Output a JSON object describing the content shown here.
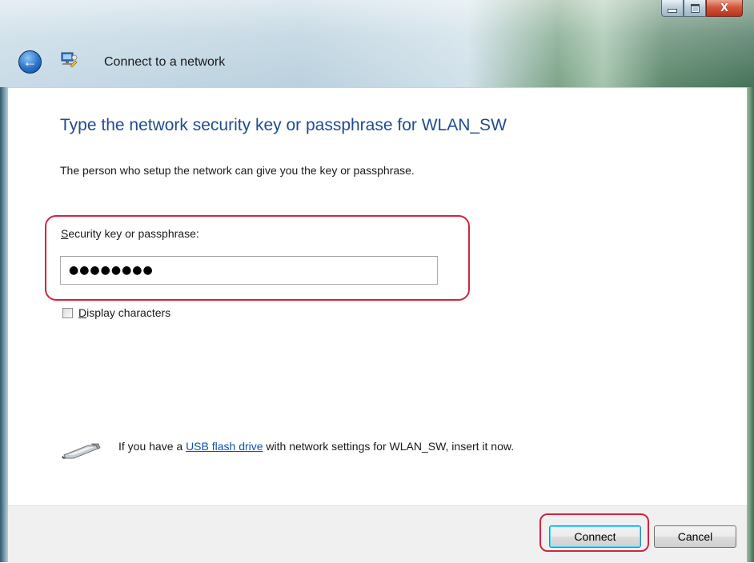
{
  "window": {
    "title": "Connect to a network",
    "controls": {
      "minimize_icon": "minimize-icon",
      "maximize_icon": "maximize-icon",
      "close_glyph": "X"
    },
    "back_glyph": "←"
  },
  "main": {
    "heading": "Type the network security key or passphrase for WLAN_SW",
    "description": "The person who setup the network can give you the key or passphrase.",
    "key_label_accel": "S",
    "key_label_rest": "ecurity key or passphrase:",
    "key_value": "●●●●●●●●",
    "display_chars_accel": "D",
    "display_chars_rest": "isplay characters",
    "display_chars_checked": false,
    "usb_prefix": "If you have a ",
    "usb_link": "USB flash drive",
    "usb_suffix": " with network settings for WLAN_SW, insert it now."
  },
  "buttons": {
    "connect": "Connect",
    "cancel": "Cancel"
  },
  "colors": {
    "heading": "#1f4c8f",
    "link": "#0b53ad",
    "highlight": "#d2233f"
  }
}
